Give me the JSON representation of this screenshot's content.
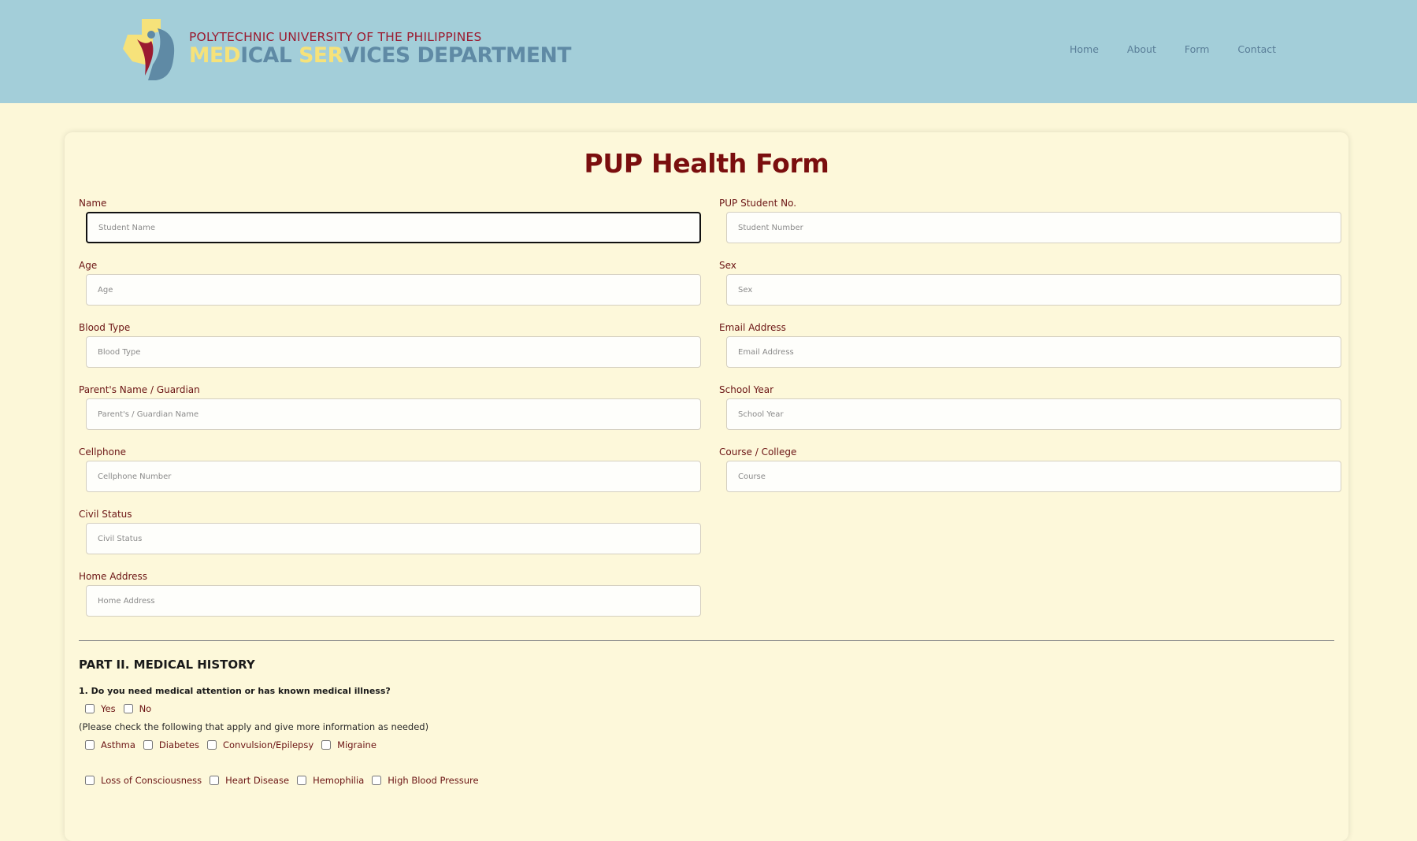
{
  "header": {
    "logo_line1": "POLYTECHNIC UNIVERSITY OF THE PHILIPPINES",
    "logo_line2_parts": [
      "MED",
      "ICAL ",
      "SER",
      "VICES DEPARTMENT"
    ],
    "nav": [
      "Home",
      "About",
      "Form",
      "Contact"
    ]
  },
  "form": {
    "title": "PUP Health Form",
    "fields": {
      "name": {
        "label": "Name",
        "placeholder": "Student Name"
      },
      "student_no": {
        "label": "PUP Student No.",
        "placeholder": "Student Number"
      },
      "age": {
        "label": "Age",
        "placeholder": "Age"
      },
      "sex": {
        "label": "Sex",
        "placeholder": "Sex"
      },
      "blood_type": {
        "label": "Blood Type",
        "placeholder": "Blood Type"
      },
      "email": {
        "label": "Email Address",
        "placeholder": "Email Address"
      },
      "parent": {
        "label": "Parent's Name / Guardian",
        "placeholder": "Parent's / Guardian Name"
      },
      "school_year": {
        "label": "School Year",
        "placeholder": "School Year"
      },
      "cellphone": {
        "label": "Cellphone",
        "placeholder": "Cellphone Number"
      },
      "course": {
        "label": "Course / College",
        "placeholder": "Course"
      },
      "civil_status": {
        "label": "Civil Status",
        "placeholder": "Civil Status"
      },
      "home_address": {
        "label": "Home Address",
        "placeholder": "Home Address"
      }
    },
    "part2": {
      "title": "PART II. MEDICAL HISTORY",
      "q1": "1. Do you need medical attention or has known medical illness?",
      "yes": "Yes",
      "no": "No",
      "note": "(Please check the following that apply and give more information as needed)",
      "illnesses_row1": [
        "Asthma",
        "Diabetes",
        "Convulsion/Epilepsy",
        "Migraine"
      ],
      "illnesses_row2": [
        "Loss of Consciousness",
        "Heart Disease",
        "Hemophilia",
        "High Blood Pressure"
      ]
    }
  },
  "colors": {
    "header_bg": "#a3ced9",
    "page_bg": "#fcf7d8",
    "title": "#7a0e0e",
    "label": "#6b1414"
  }
}
